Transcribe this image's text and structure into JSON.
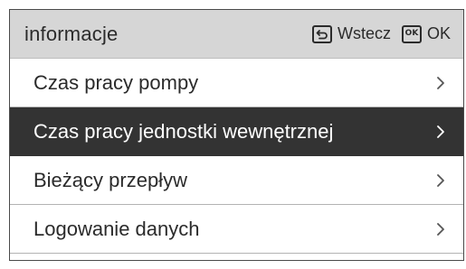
{
  "header": {
    "title": "informacje",
    "back_label": "Wstecz",
    "ok_key_label": "OK",
    "ok_label": "OK",
    "back_icon": "return-arrow-icon",
    "ok_icon": "ok-key-icon"
  },
  "menu": {
    "items": [
      {
        "label": "Czas pracy pompy",
        "selected": false
      },
      {
        "label": "Czas pracy jednostki wewnętrznej",
        "selected": true
      },
      {
        "label": "Bieżący przepływ",
        "selected": false
      },
      {
        "label": "Logowanie danych",
        "selected": false
      }
    ],
    "chevron_icon": "chevron-right-icon"
  },
  "colors": {
    "header_bg": "#d6d6d6",
    "selected_bg": "#333333",
    "text": "#2b2b2b",
    "selected_text": "#ffffff"
  }
}
